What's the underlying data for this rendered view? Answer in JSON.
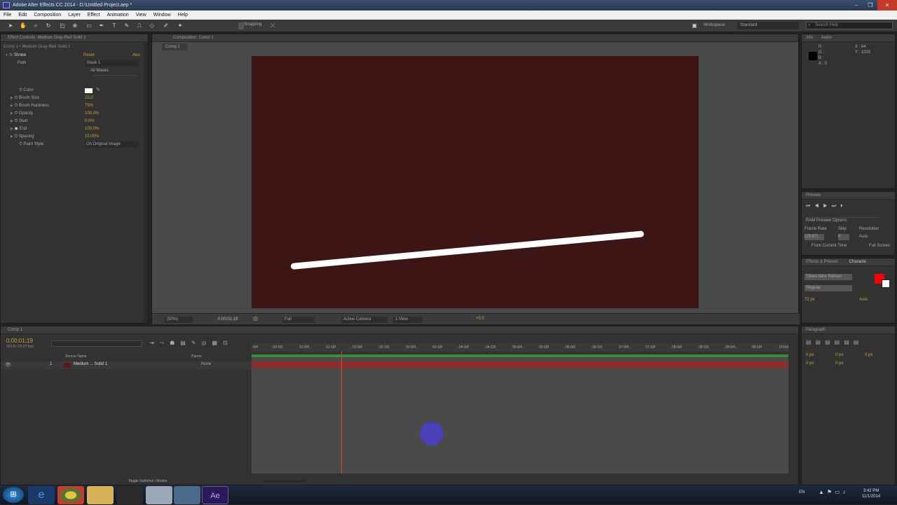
{
  "window": {
    "title": "Adobe After Effects CC 2014 - D:\\Untitled Project.aep *"
  },
  "menu": [
    "File",
    "Edit",
    "Composition",
    "Layer",
    "Effect",
    "Animation",
    "View",
    "Window",
    "Help"
  ],
  "toolbar": {
    "snapping": "Snapping",
    "workspace_label": "Workspace:",
    "workspace_value": "Standard",
    "search_placeholder": "Search Help"
  },
  "effect_controls": {
    "tab": "Effect Controls: Medium Gray-Red Solid 1",
    "breadcrumb": "Comp 1 • Medium Gray-Red Solid 1",
    "effect_name": "Stroke",
    "reset": "Reset",
    "about": "Abo",
    "path_label": "Path",
    "path_value": "Mask 1",
    "all_masks": "All Masks",
    "params": [
      {
        "label": "Color",
        "value": ""
      },
      {
        "label": "Brush Size",
        "value": "15.0"
      },
      {
        "label": "Brush Hardness",
        "value": "75%"
      },
      {
        "label": "Opacity",
        "value": "100.0%"
      },
      {
        "label": "Start",
        "value": "0.0%"
      },
      {
        "label": "End",
        "value": "100.0%"
      },
      {
        "label": "Spacing",
        "value": "15.00%"
      },
      {
        "label": "Paint Style",
        "value": "On Original Image"
      }
    ]
  },
  "composition": {
    "tab": "Composition: Comp 1",
    "subtab": "Comp 1",
    "zoom": "(50%)",
    "timecode": "0;00;01;19",
    "resolution": "Full",
    "camera": "Active Camera",
    "view": "1 View",
    "exposure": "+0.0"
  },
  "info": {
    "tab": "Info",
    "audio_tab": "Audio",
    "r": "R :",
    "g": "G :",
    "b": "B :",
    "a": "A : 0",
    "x": "X : 64",
    "y": "Y : 1002"
  },
  "preview": {
    "tab": "Preview",
    "ram_options": "RAM Preview Options",
    "frame_rate_label": "Frame Rate",
    "skip_label": "Skip",
    "resolution_label": "Resolution",
    "frame_rate": "(29.97)",
    "skip": "0",
    "resolution": "Auto",
    "from_current": "From Current Time",
    "full_screen": "Full Screen"
  },
  "effects_presets": {
    "tab": "Effects & Presets",
    "character_tab": "Characte"
  },
  "character": {
    "font": "Times New Roman",
    "style": "Regular",
    "size": "72 px",
    "leading": "Auto",
    "fill_color": "#ff0000"
  },
  "timeline": {
    "tab": "Comp 1",
    "timecode": "0;00;01;19",
    "fps": "00049 (29.97 fps)",
    "col_source": "Source Name",
    "col_parent": "Parent",
    "layer_number": "1",
    "layer_name": "Medium ... Solid 1",
    "parent_value": "None",
    "ticks": [
      "00f",
      "00:15f",
      "01:00f",
      "01:15f",
      "02:00f",
      "02:15f",
      "03:00f",
      "03:15f",
      "04:00f",
      "04:15f",
      "05:00f",
      "05:15f",
      "06:00f",
      "06:15f",
      "07:00f",
      "07:15f",
      "08:00f",
      "08:15f",
      "09:00f",
      "09:15f",
      "10:00f"
    ],
    "toggle_label": "Toggle Switches / Modes"
  },
  "paragraph": {
    "tab": "Paragraph",
    "indent_left": "0 px",
    "indent_right": "0 px",
    "space_before": "0 px",
    "space_after": "0 px",
    "first_indent": "0 px"
  },
  "taskbar": {
    "lang": "EN",
    "time": "3:42 PM",
    "date": "11/1/2014"
  }
}
